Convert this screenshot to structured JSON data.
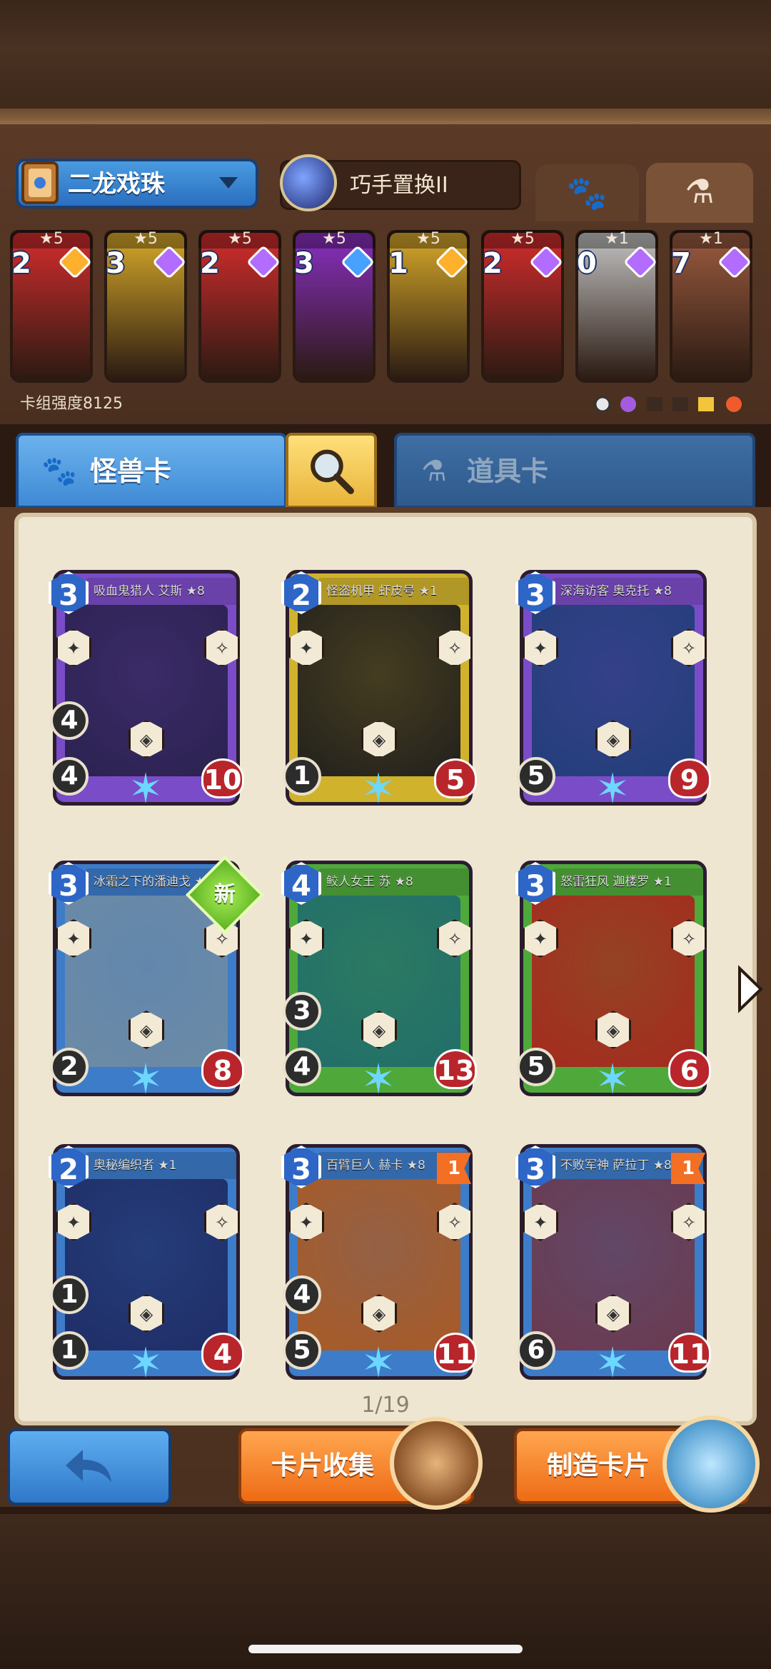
{
  "deck": {
    "name": "二龙戏珠",
    "skill_name": "巧手置换II",
    "power_label": "卡组强度8125",
    "cards": [
      {
        "stars": "★5",
        "cost": "2",
        "color": "#d42d2d",
        "gem": "#ffb12e"
      },
      {
        "stars": "★5",
        "cost": "3",
        "color": "#d7a92a",
        "gem": "#b26cff"
      },
      {
        "stars": "★5",
        "cost": "2",
        "color": "#d42d2d",
        "gem": "#b26cff"
      },
      {
        "stars": "★5",
        "cost": "3",
        "color": "#8a2fc2",
        "gem": "#49a1ff"
      },
      {
        "stars": "★5",
        "cost": "1",
        "color": "#d7a92a",
        "gem": "#ffb12e"
      },
      {
        "stars": "★5",
        "cost": "2",
        "color": "#d42d2d",
        "gem": "#b26cff"
      },
      {
        "stars": "★1",
        "cost": "0",
        "color": "#c4c4c4",
        "gem": "#b26cff"
      },
      {
        "stars": "★1",
        "cost": "7",
        "color": "#9b5b3f",
        "gem": "#b26cff"
      }
    ]
  },
  "tabs": {
    "monster": "怪兽卡",
    "item": "道具卡"
  },
  "cards": [
    {
      "title": "吸血鬼猎人 艾斯 ★8",
      "cost": "3",
      "atk": "4",
      "hp": "10",
      "extra": "4",
      "frame": "#7b4cc7",
      "art": "#2b2250"
    },
    {
      "title": "怪盗机甲 虾皮号 ★1",
      "cost": "2",
      "atk": "1",
      "hp": "5",
      "extra": "",
      "frame": "#d0b22c",
      "art": "#22201d"
    },
    {
      "title": "深海访客 奥克托 ★8",
      "cost": "3",
      "atk": "5",
      "hp": "9",
      "extra": "",
      "frame": "#7b4cc7",
      "art": "#233e7a"
    },
    {
      "title": "冰霜之下的潘迪戈 ★1",
      "cost": "3",
      "atk": "2",
      "hp": "8",
      "extra": "",
      "frame": "#3c7cc9",
      "art": "#6c8aa5"
    },
    {
      "title": "鲛人女王 苏 ★8",
      "cost": "4",
      "atk": "4",
      "hp": "13",
      "extra": "3",
      "frame": "#4fa83a",
      "art": "#226e6b"
    },
    {
      "title": "怒雷狂风 迦楼罗 ★1",
      "cost": "3",
      "atk": "5",
      "hp": "6",
      "extra": "",
      "frame": "#4fa83a",
      "art": "#a52a1e"
    },
    {
      "title": "奥秘编织者 ★1",
      "cost": "2",
      "atk": "1",
      "hp": "4",
      "extra": "1",
      "frame": "#3c7cc9",
      "art": "#1f2d66"
    },
    {
      "title": "百臂巨人 赫卡 ★8",
      "cost": "3",
      "atk": "5",
      "hp": "11",
      "extra": "4",
      "frame": "#3c7cc9",
      "art": "#a95a25"
    },
    {
      "title": "不败军神 萨拉丁 ★8",
      "cost": "3",
      "atk": "6",
      "hp": "11",
      "extra": "",
      "frame": "#3c7cc9",
      "art": "#6b3a4f"
    }
  ],
  "new_badge": "新",
  "flag_value": "1",
  "pager": "1/19",
  "buttons": {
    "collect": "卡片收集",
    "craft": "制造卡片"
  }
}
